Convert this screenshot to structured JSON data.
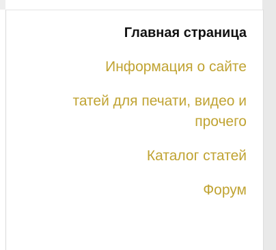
{
  "nav": {
    "items": [
      {
        "label": "Главная страница",
        "active": true
      },
      {
        "label": "Информация о сайте",
        "active": false
      },
      {
        "label_line1": "татей для печати, видео и",
        "label_line2": "прочего",
        "active": false
      },
      {
        "label": "Каталог статей",
        "active": false
      },
      {
        "label": "Форум",
        "active": false
      }
    ]
  },
  "colors": {
    "link": "#c0a332",
    "active": "#111111",
    "gutter": "#e9e9e9"
  }
}
